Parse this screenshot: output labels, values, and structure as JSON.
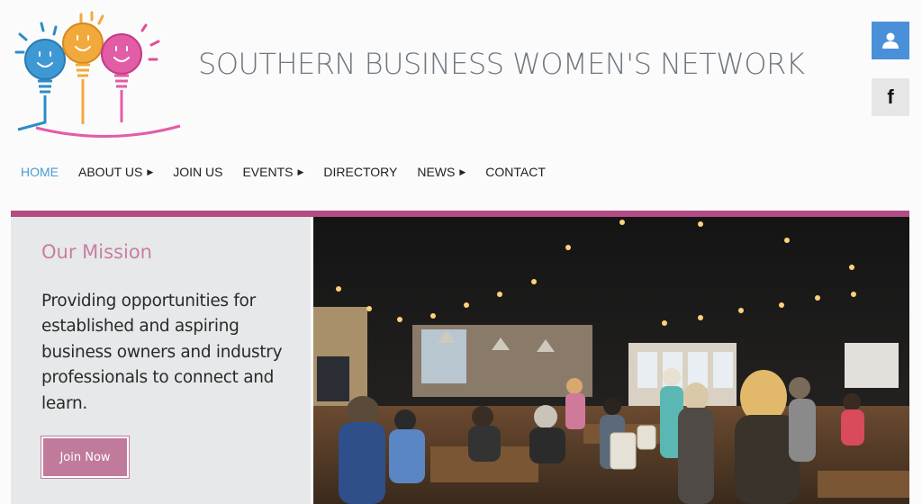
{
  "header": {
    "site_title": "SOUTHERN BUSINESS WOMEN'S NETWORK",
    "logo": "three-lightbulbs-logo"
  },
  "social": {
    "user_icon": "user-icon",
    "facebook_icon": "facebook-icon",
    "facebook_glyph": "f"
  },
  "nav": {
    "items": [
      {
        "label": "HOME",
        "active": true,
        "has_submenu": false
      },
      {
        "label": "ABOUT US",
        "active": false,
        "has_submenu": true
      },
      {
        "label": "JOIN US",
        "active": false,
        "has_submenu": false
      },
      {
        "label": "EVENTS",
        "active": false,
        "has_submenu": true
      },
      {
        "label": "DIRECTORY",
        "active": false,
        "has_submenu": false
      },
      {
        "label": "NEWS",
        "active": false,
        "has_submenu": true
      },
      {
        "label": "CONTACT",
        "active": false,
        "has_submenu": false
      }
    ],
    "caret": "▶"
  },
  "mission": {
    "title": "Our Mission",
    "text": "Providing opportunities for established and aspiring business owners and industry professionals to connect and learn.",
    "button_label": "Join Now"
  },
  "colors": {
    "accent_pink": "#b34b84",
    "nav_active": "#4a9bd1",
    "button": "#c07a9c",
    "user_button": "#4a90d9"
  }
}
